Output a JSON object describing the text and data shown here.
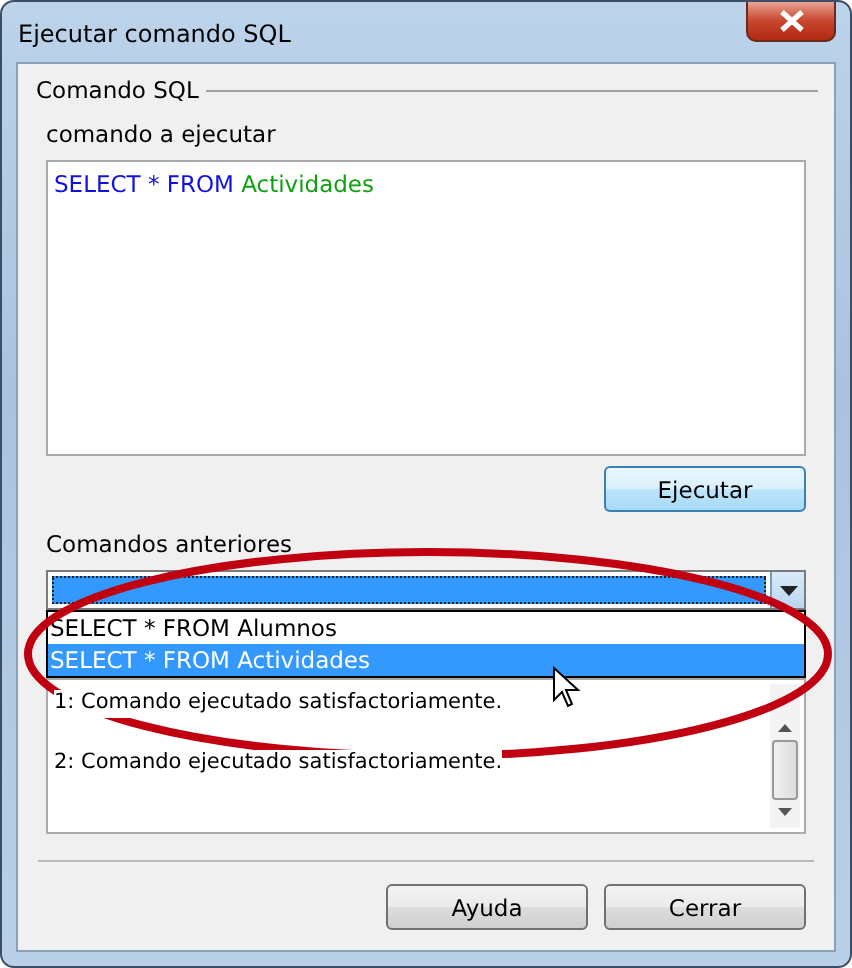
{
  "window": {
    "title": "Ejecutar comando SQL"
  },
  "sql_group": {
    "title": "Comando SQL",
    "command_label": "comando a ejecutar",
    "command_tokens": [
      {
        "text": "SELECT * FROM",
        "kind": "keyword"
      },
      {
        "text": "Actividades",
        "kind": "identifier"
      }
    ],
    "execute_button": "Ejecutar"
  },
  "history": {
    "label": "Comandos anteriores",
    "expanded": true,
    "options": [
      {
        "label": "SELECT * FROM Alumnos",
        "selected": false
      },
      {
        "label": "SELECT * FROM Actividades",
        "selected": true
      }
    ]
  },
  "output": {
    "lines": [
      "1: Comando ejecutado satisfactoriamente.",
      "2: Comando ejecutado satisfactoriamente."
    ]
  },
  "buttons": [
    {
      "label": "Ayuda"
    },
    {
      "label": "Cerrar"
    }
  ]
}
